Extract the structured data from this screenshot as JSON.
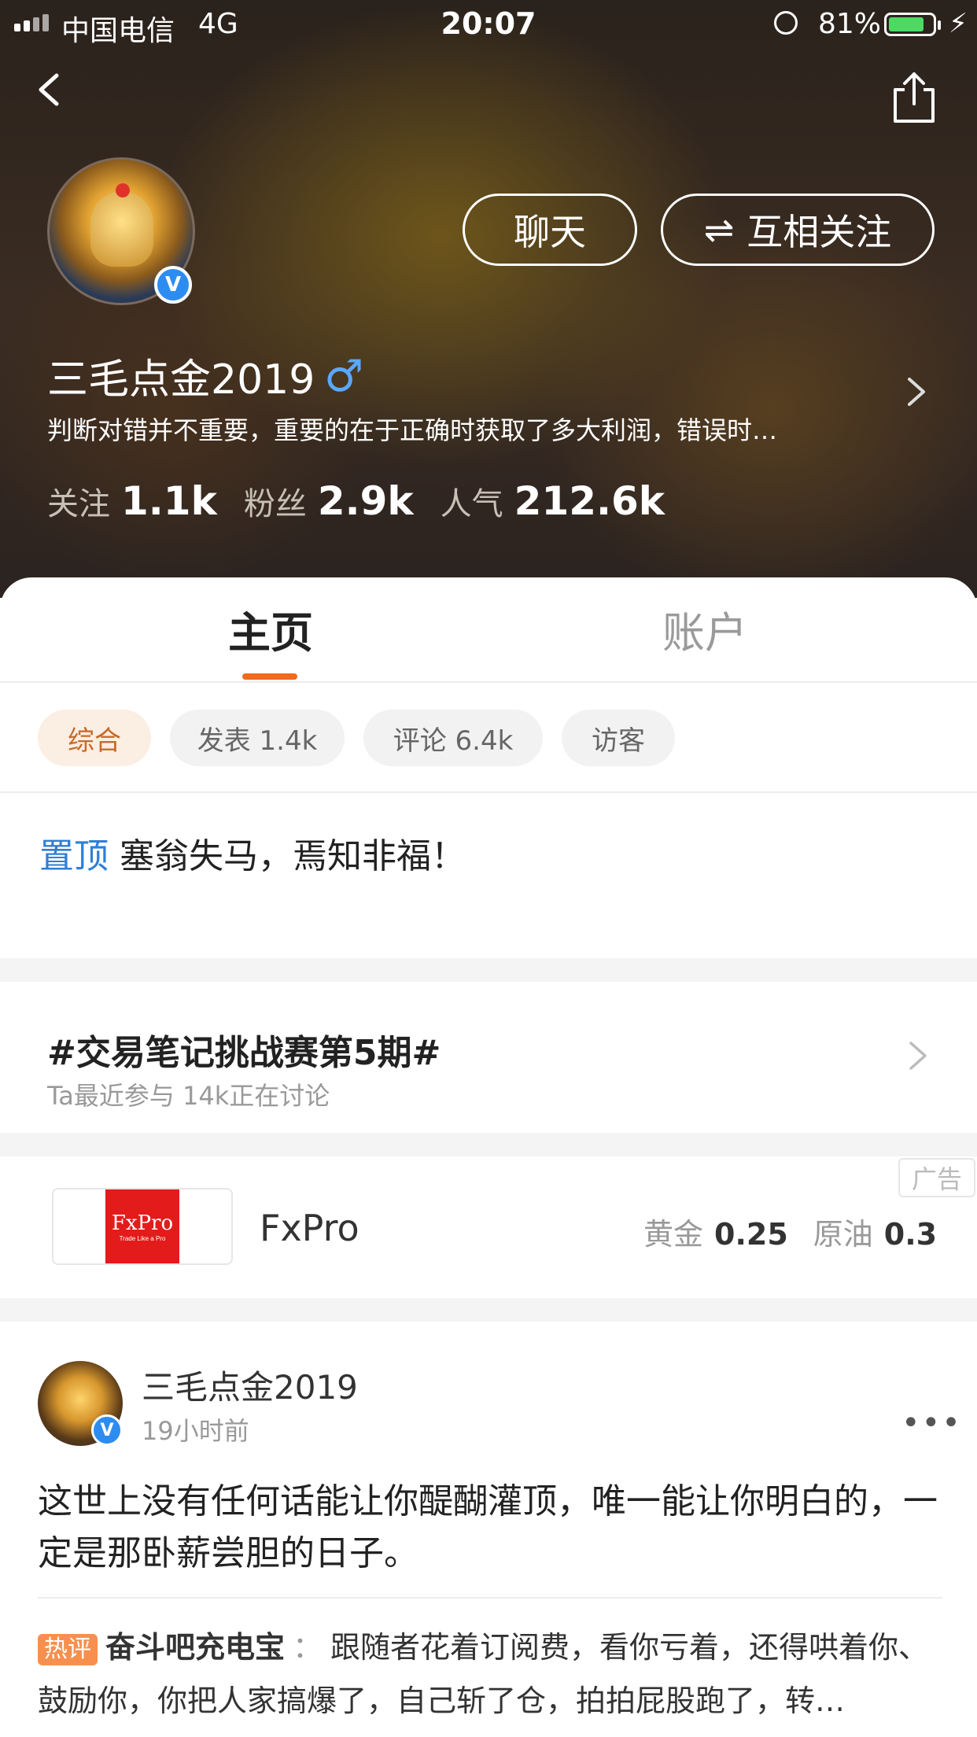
{
  "status_bar": {
    "carrier": "中国电信",
    "network": "4G",
    "time": "20:07",
    "battery": "81%"
  },
  "profile": {
    "chat_button": "聊天",
    "follow_icon": "⇌",
    "follow_button": "互相关注",
    "username": "三毛点金2019",
    "gender_symbol": "♂",
    "verified_mark": "V",
    "bio": "判断对错并不重要，重要的在于正确时获取了多大利润，错误时…",
    "stats": [
      {
        "label": "关注",
        "value": "1.1k"
      },
      {
        "label": "粉丝",
        "value": "2.9k"
      },
      {
        "label": "人气",
        "value": "212.6k"
      }
    ]
  },
  "tabs": [
    {
      "label": "主页",
      "active": true
    },
    {
      "label": "账户",
      "active": false
    }
  ],
  "filters": [
    {
      "label": "综合",
      "active": true
    },
    {
      "label": "发表 1.4k",
      "active": false
    },
    {
      "label": "评论 6.4k",
      "active": false
    },
    {
      "label": "访客",
      "active": false
    }
  ],
  "pinned": {
    "tag": "置顶",
    "text": "塞翁失马，焉知非福！"
  },
  "topic": {
    "title": "#交易笔记挑战赛第5期#",
    "meta": "Ta最近参与   14k正在讨论"
  },
  "ad": {
    "tag": "广告",
    "logo_text": "FxPro",
    "logo_sub": "Trade Like a Pro",
    "name": "FxPro",
    "quotes": [
      {
        "label": "黄金",
        "value": "0.25"
      },
      {
        "label": "原油",
        "value": "0.3"
      }
    ]
  },
  "post": {
    "author": "三毛点金2019",
    "time": "19小时前",
    "more": "•••",
    "body": "这世上没有任何话能让你醍醐灌顶，唯一能让你明白的，一定是那卧薪尝胆的日子。",
    "hot_comment": {
      "badge": "热评",
      "user": "奋斗吧充电宝",
      "colon": "：",
      "text": "跟随者花着订阅费，看你亏着，还得哄着你、鼓励你，你把人家搞爆了，自己斩了仓，拍拍屁股跑了，转…"
    }
  },
  "colors": {
    "accent_orange": "#f26a1b",
    "link_blue": "#2f7fd6",
    "verified_blue": "#2d8cf0",
    "battery_green": "#4cd964",
    "ad_red": "#e31b1b"
  }
}
